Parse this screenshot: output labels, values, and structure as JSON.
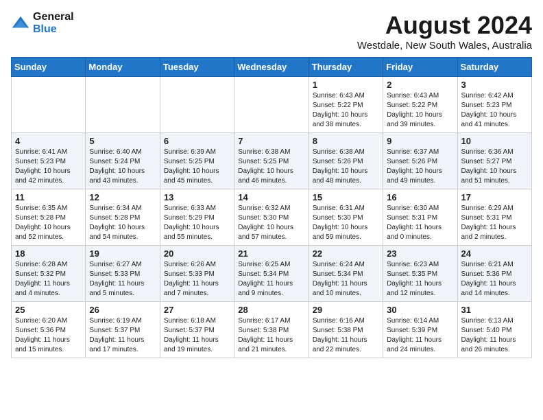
{
  "header": {
    "logo_line1": "General",
    "logo_line2": "Blue",
    "month_year": "August 2024",
    "location": "Westdale, New South Wales, Australia"
  },
  "days_of_week": [
    "Sunday",
    "Monday",
    "Tuesday",
    "Wednesday",
    "Thursday",
    "Friday",
    "Saturday"
  ],
  "weeks": [
    [
      {
        "day": "",
        "info": ""
      },
      {
        "day": "",
        "info": ""
      },
      {
        "day": "",
        "info": ""
      },
      {
        "day": "",
        "info": ""
      },
      {
        "day": "1",
        "info": "Sunrise: 6:43 AM\nSunset: 5:22 PM\nDaylight: 10 hours\nand 38 minutes."
      },
      {
        "day": "2",
        "info": "Sunrise: 6:43 AM\nSunset: 5:22 PM\nDaylight: 10 hours\nand 39 minutes."
      },
      {
        "day": "3",
        "info": "Sunrise: 6:42 AM\nSunset: 5:23 PM\nDaylight: 10 hours\nand 41 minutes."
      }
    ],
    [
      {
        "day": "4",
        "info": "Sunrise: 6:41 AM\nSunset: 5:23 PM\nDaylight: 10 hours\nand 42 minutes."
      },
      {
        "day": "5",
        "info": "Sunrise: 6:40 AM\nSunset: 5:24 PM\nDaylight: 10 hours\nand 43 minutes."
      },
      {
        "day": "6",
        "info": "Sunrise: 6:39 AM\nSunset: 5:25 PM\nDaylight: 10 hours\nand 45 minutes."
      },
      {
        "day": "7",
        "info": "Sunrise: 6:38 AM\nSunset: 5:25 PM\nDaylight: 10 hours\nand 46 minutes."
      },
      {
        "day": "8",
        "info": "Sunrise: 6:38 AM\nSunset: 5:26 PM\nDaylight: 10 hours\nand 48 minutes."
      },
      {
        "day": "9",
        "info": "Sunrise: 6:37 AM\nSunset: 5:26 PM\nDaylight: 10 hours\nand 49 minutes."
      },
      {
        "day": "10",
        "info": "Sunrise: 6:36 AM\nSunset: 5:27 PM\nDaylight: 10 hours\nand 51 minutes."
      }
    ],
    [
      {
        "day": "11",
        "info": "Sunrise: 6:35 AM\nSunset: 5:28 PM\nDaylight: 10 hours\nand 52 minutes."
      },
      {
        "day": "12",
        "info": "Sunrise: 6:34 AM\nSunset: 5:28 PM\nDaylight: 10 hours\nand 54 minutes."
      },
      {
        "day": "13",
        "info": "Sunrise: 6:33 AM\nSunset: 5:29 PM\nDaylight: 10 hours\nand 55 minutes."
      },
      {
        "day": "14",
        "info": "Sunrise: 6:32 AM\nSunset: 5:30 PM\nDaylight: 10 hours\nand 57 minutes."
      },
      {
        "day": "15",
        "info": "Sunrise: 6:31 AM\nSunset: 5:30 PM\nDaylight: 10 hours\nand 59 minutes."
      },
      {
        "day": "16",
        "info": "Sunrise: 6:30 AM\nSunset: 5:31 PM\nDaylight: 11 hours\nand 0 minutes."
      },
      {
        "day": "17",
        "info": "Sunrise: 6:29 AM\nSunset: 5:31 PM\nDaylight: 11 hours\nand 2 minutes."
      }
    ],
    [
      {
        "day": "18",
        "info": "Sunrise: 6:28 AM\nSunset: 5:32 PM\nDaylight: 11 hours\nand 4 minutes."
      },
      {
        "day": "19",
        "info": "Sunrise: 6:27 AM\nSunset: 5:33 PM\nDaylight: 11 hours\nand 5 minutes."
      },
      {
        "day": "20",
        "info": "Sunrise: 6:26 AM\nSunset: 5:33 PM\nDaylight: 11 hours\nand 7 minutes."
      },
      {
        "day": "21",
        "info": "Sunrise: 6:25 AM\nSunset: 5:34 PM\nDaylight: 11 hours\nand 9 minutes."
      },
      {
        "day": "22",
        "info": "Sunrise: 6:24 AM\nSunset: 5:34 PM\nDaylight: 11 hours\nand 10 minutes."
      },
      {
        "day": "23",
        "info": "Sunrise: 6:23 AM\nSunset: 5:35 PM\nDaylight: 11 hours\nand 12 minutes."
      },
      {
        "day": "24",
        "info": "Sunrise: 6:21 AM\nSunset: 5:36 PM\nDaylight: 11 hours\nand 14 minutes."
      }
    ],
    [
      {
        "day": "25",
        "info": "Sunrise: 6:20 AM\nSunset: 5:36 PM\nDaylight: 11 hours\nand 15 minutes."
      },
      {
        "day": "26",
        "info": "Sunrise: 6:19 AM\nSunset: 5:37 PM\nDaylight: 11 hours\nand 17 minutes."
      },
      {
        "day": "27",
        "info": "Sunrise: 6:18 AM\nSunset: 5:37 PM\nDaylight: 11 hours\nand 19 minutes."
      },
      {
        "day": "28",
        "info": "Sunrise: 6:17 AM\nSunset: 5:38 PM\nDaylight: 11 hours\nand 21 minutes."
      },
      {
        "day": "29",
        "info": "Sunrise: 6:16 AM\nSunset: 5:38 PM\nDaylight: 11 hours\nand 22 minutes."
      },
      {
        "day": "30",
        "info": "Sunrise: 6:14 AM\nSunset: 5:39 PM\nDaylight: 11 hours\nand 24 minutes."
      },
      {
        "day": "31",
        "info": "Sunrise: 6:13 AM\nSunset: 5:40 PM\nDaylight: 11 hours\nand 26 minutes."
      }
    ]
  ]
}
